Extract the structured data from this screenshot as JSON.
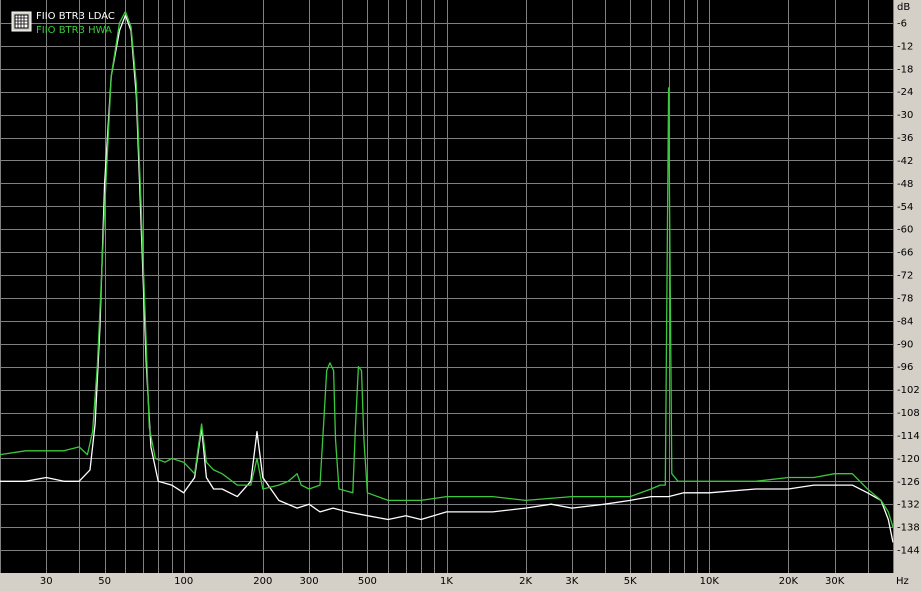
{
  "chart_data": {
    "type": "line",
    "x_scale": "log",
    "xlim": [
      20,
      50000
    ],
    "ylim": [
      -150,
      0
    ],
    "grid": true,
    "y_unit": "dB",
    "x_unit": "Hz",
    "y_ticks": [
      -6,
      -12,
      -18,
      -24,
      -30,
      -36,
      -42,
      -48,
      -54,
      -60,
      -66,
      -72,
      -78,
      -84,
      -90,
      -96,
      -102,
      -108,
      -114,
      -120,
      -126,
      -132,
      -138,
      -144
    ],
    "x_tick_labels": [
      {
        "value": 30,
        "label": "30"
      },
      {
        "value": 50,
        "label": "50"
      },
      {
        "value": 100,
        "label": "100"
      },
      {
        "value": 200,
        "label": "200"
      },
      {
        "value": 300,
        "label": "300"
      },
      {
        "value": 500,
        "label": "500"
      },
      {
        "value": 1000,
        "label": "1K"
      },
      {
        "value": 2000,
        "label": "2K"
      },
      {
        "value": 3000,
        "label": "3K"
      },
      {
        "value": 5000,
        "label": "5K"
      },
      {
        "value": 10000,
        "label": "10K"
      },
      {
        "value": 20000,
        "label": "20K"
      },
      {
        "value": 30000,
        "label": "30K"
      }
    ],
    "legend_position": "top-left",
    "colors": {
      "plot_bg": "#000000",
      "grid": "#808080",
      "frame_bg": "#d4d0c8"
    },
    "series": [
      {
        "name": "FIIO BTR3 LDAC",
        "color": "#ffffff",
        "points": [
          [
            20,
            -126
          ],
          [
            25,
            -126
          ],
          [
            30,
            -125
          ],
          [
            35,
            -126
          ],
          [
            40,
            -126
          ],
          [
            44,
            -123
          ],
          [
            46,
            -111
          ],
          [
            48,
            -86
          ],
          [
            50,
            -48
          ],
          [
            53,
            -20
          ],
          [
            57,
            -8
          ],
          [
            60,
            -4
          ],
          [
            63,
            -8
          ],
          [
            66,
            -25
          ],
          [
            69,
            -60
          ],
          [
            72,
            -95
          ],
          [
            75,
            -117
          ],
          [
            80,
            -126
          ],
          [
            90,
            -127
          ],
          [
            100,
            -129
          ],
          [
            110,
            -125
          ],
          [
            117,
            -112
          ],
          [
            122,
            -125
          ],
          [
            130,
            -128
          ],
          [
            140,
            -128
          ],
          [
            160,
            -130
          ],
          [
            180,
            -126
          ],
          [
            190,
            -113
          ],
          [
            200,
            -125
          ],
          [
            230,
            -131
          ],
          [
            270,
            -133
          ],
          [
            300,
            -132
          ],
          [
            330,
            -134
          ],
          [
            370,
            -133
          ],
          [
            420,
            -134
          ],
          [
            500,
            -135
          ],
          [
            600,
            -136
          ],
          [
            700,
            -135
          ],
          [
            800,
            -136
          ],
          [
            1000,
            -134
          ],
          [
            1200,
            -134
          ],
          [
            1500,
            -134
          ],
          [
            2000,
            -133
          ],
          [
            2500,
            -132
          ],
          [
            3000,
            -133
          ],
          [
            4000,
            -132
          ],
          [
            5000,
            -131
          ],
          [
            6000,
            -130
          ],
          [
            7000,
            -130
          ],
          [
            8000,
            -129
          ],
          [
            10000,
            -129
          ],
          [
            15000,
            -128
          ],
          [
            20000,
            -128
          ],
          [
            25000,
            -127
          ],
          [
            30000,
            -127
          ],
          [
            35000,
            -127
          ],
          [
            40000,
            -129
          ],
          [
            45000,
            -131
          ],
          [
            48000,
            -136
          ],
          [
            50000,
            -142
          ]
        ]
      },
      {
        "name": "FIIO BTR3 HWA",
        "color": "#3cc83c",
        "points": [
          [
            20,
            -119
          ],
          [
            25,
            -118
          ],
          [
            30,
            -118
          ],
          [
            35,
            -118
          ],
          [
            40,
            -117
          ],
          [
            43,
            -119
          ],
          [
            45,
            -113
          ],
          [
            47,
            -95
          ],
          [
            50,
            -55
          ],
          [
            53,
            -20
          ],
          [
            57,
            -6
          ],
          [
            60,
            -3
          ],
          [
            63,
            -7
          ],
          [
            66,
            -22
          ],
          [
            69,
            -55
          ],
          [
            72,
            -90
          ],
          [
            74,
            -112
          ],
          [
            78,
            -120
          ],
          [
            85,
            -121
          ],
          [
            90,
            -120
          ],
          [
            100,
            -121
          ],
          [
            110,
            -124
          ],
          [
            117,
            -111
          ],
          [
            122,
            -121
          ],
          [
            130,
            -123
          ],
          [
            140,
            -124
          ],
          [
            160,
            -127
          ],
          [
            180,
            -127
          ],
          [
            190,
            -120
          ],
          [
            200,
            -128
          ],
          [
            230,
            -127
          ],
          [
            250,
            -126
          ],
          [
            270,
            -124
          ],
          [
            280,
            -127
          ],
          [
            300,
            -128
          ],
          [
            330,
            -127
          ],
          [
            340,
            -112
          ],
          [
            350,
            -97
          ],
          [
            360,
            -95
          ],
          [
            372,
            -97
          ],
          [
            378,
            -115
          ],
          [
            390,
            -128
          ],
          [
            440,
            -129
          ],
          [
            450,
            -112
          ],
          [
            462,
            -96
          ],
          [
            475,
            -97
          ],
          [
            485,
            -115
          ],
          [
            500,
            -129
          ],
          [
            600,
            -131
          ],
          [
            800,
            -131
          ],
          [
            1000,
            -130
          ],
          [
            1500,
            -130
          ],
          [
            2000,
            -131
          ],
          [
            3000,
            -130
          ],
          [
            4000,
            -130
          ],
          [
            5000,
            -130
          ],
          [
            6000,
            -128
          ],
          [
            6500,
            -127
          ],
          [
            6800,
            -127
          ],
          [
            7000,
            -23
          ],
          [
            7200,
            -124
          ],
          [
            7600,
            -126
          ],
          [
            8000,
            -126
          ],
          [
            10000,
            -126
          ],
          [
            15000,
            -126
          ],
          [
            20000,
            -125
          ],
          [
            25000,
            -125
          ],
          [
            30000,
            -124
          ],
          [
            35000,
            -124
          ],
          [
            40000,
            -128
          ],
          [
            45000,
            -131
          ],
          [
            48000,
            -134
          ],
          [
            50000,
            -138
          ]
        ]
      }
    ]
  }
}
